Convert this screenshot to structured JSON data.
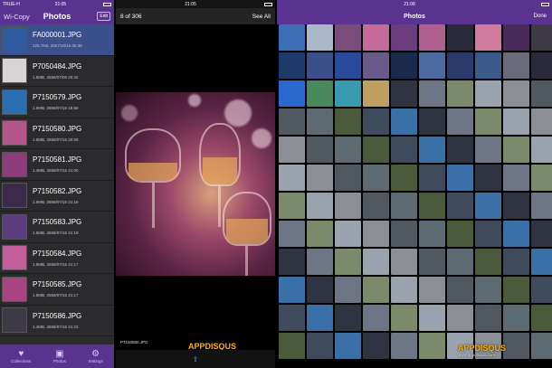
{
  "left": {
    "status": {
      "carrier": "TRUE-H",
      "time": "21:05"
    },
    "back_label": "Wi-Copy",
    "title": "Photos",
    "edit_label": "Edit",
    "files": [
      {
        "name": "FA000001.JPG",
        "info": "125.7KB, 2557/10/15 06:36",
        "color": "#2f5aa0"
      },
      {
        "name": "P7050484.JPG",
        "info": "1.5MB, 2558/07/05 20:42",
        "color": "#d9d3d5"
      },
      {
        "name": "P7150579.JPG",
        "info": "1.5MB, 2558/07/15 18:58",
        "color": "#2b6fb3"
      },
      {
        "name": "P7150580.JPG",
        "info": "1.5MB, 2558/07/15 20:59",
        "color": "#b4568a"
      },
      {
        "name": "P7150581.JPG",
        "info": "1.4MB, 2558/07/15 21:00",
        "color": "#8c3d7a"
      },
      {
        "name": "P7150582.JPG",
        "info": "1.5MB, 2558/07/15 21:16",
        "color": "#3c2a4a"
      },
      {
        "name": "P7150583.JPG",
        "info": "1.5MB, 2558/07/15 21:19",
        "color": "#5a3d7c"
      },
      {
        "name": "P7150584.JPG",
        "info": "1.5MB, 2558/07/15 21:17",
        "color": "#c25f9a"
      },
      {
        "name": "P7150585.JPG",
        "info": "1.5MB, 2558/07/15 21:17",
        "color": "#a8447f"
      },
      {
        "name": "P7150586.JPG",
        "info": "1.4MB, 2558/07/15 21:23",
        "color": "#3d3a46"
      }
    ],
    "tabs": [
      {
        "label": "Collections",
        "icon": "heart-icon"
      },
      {
        "label": "Photos",
        "icon": "photos-icon"
      },
      {
        "label": "Settings",
        "icon": "gear-icon"
      }
    ]
  },
  "middle": {
    "status": {
      "time": "21:05"
    },
    "counter": "8 of 306",
    "see_all": "See All",
    "caption": "P7150580.JPG"
  },
  "right": {
    "status": {
      "time": "21:08"
    },
    "title": "Photos",
    "done_label": "Done"
  },
  "watermark": {
    "brand": "APPDISQUS",
    "url": "www.appdisqus.com"
  }
}
